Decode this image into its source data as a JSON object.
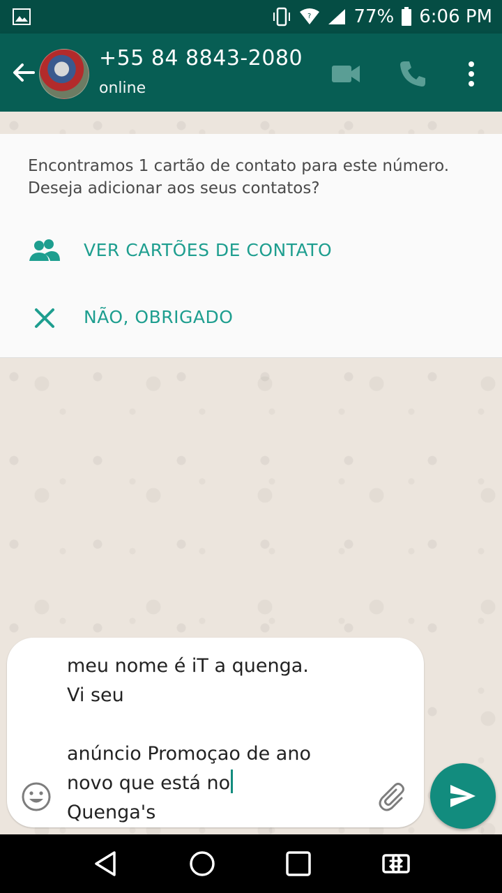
{
  "status_bar": {
    "battery_percent": "77%",
    "time": "6:06 PM"
  },
  "header": {
    "contact_name": "+55 84 8843-2080",
    "status": "online"
  },
  "contact_card_prompt": {
    "message": "Encontramos 1 cartão de contato para este número. Deseja adicionar aos seus contatos?",
    "view_cards_label": "VER CARTÕES DE CONTATO",
    "decline_label": "NÃO, OBRIGADO"
  },
  "composer": {
    "text": "meu nome é iT a quenga.\nVi seu\n\nanúncio Promoçao de ano\nnovo que está no",
    "text_after_caret": "\nQuenga's"
  },
  "colors": {
    "status_bar": "#054D44",
    "app_bar": "#075E54",
    "accent": "#128C7E",
    "link": "#1E9E8F",
    "chat_bg": "#ECE5DD"
  },
  "icons": {
    "status_left": "image-icon",
    "vibrate": "vibrate-icon",
    "wifi": "wifi-icon",
    "signal": "signal-icon",
    "battery": "battery-icon",
    "back": "arrow-left-icon",
    "video": "video-call-icon",
    "call": "phone-icon",
    "menu": "more-vert-icon",
    "group": "people-icon",
    "close": "close-icon",
    "emoji": "emoji-icon",
    "attach": "paperclip-icon",
    "send": "send-icon",
    "nav_back": "triangle-back-icon",
    "nav_home": "circle-home-icon",
    "nav_recents": "square-recents-icon",
    "nav_switch": "switch-app-icon"
  }
}
